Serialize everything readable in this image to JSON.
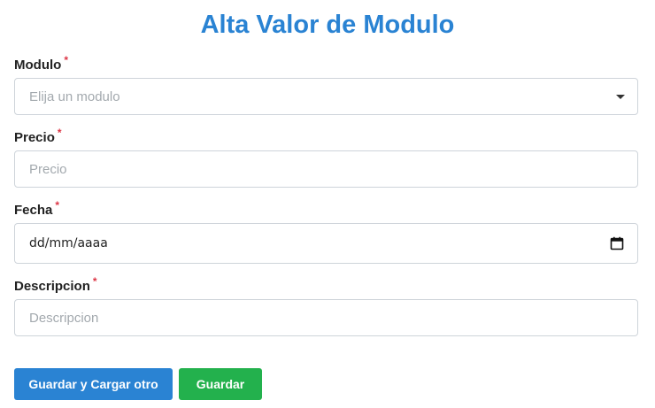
{
  "page": {
    "title": "Alta Valor de Modulo"
  },
  "form": {
    "modulo": {
      "label": "Modulo",
      "required_mark": "*",
      "placeholder": "Elija un modulo"
    },
    "precio": {
      "label": "Precio",
      "required_mark": "*",
      "placeholder": "Precio"
    },
    "fecha": {
      "label": "Fecha",
      "required_mark": "*",
      "placeholder": "dd/mm/aaaa",
      "icon": "calendar-icon"
    },
    "descripcion": {
      "label": "Descripcion",
      "required_mark": "*",
      "placeholder": "Descripcion"
    }
  },
  "actions": {
    "save_and_new_label": "Guardar y Cargar otro",
    "save_label": "Guardar"
  },
  "colors": {
    "primary": "#2a83d3",
    "success": "#23b14d",
    "required": "#dc3545"
  }
}
